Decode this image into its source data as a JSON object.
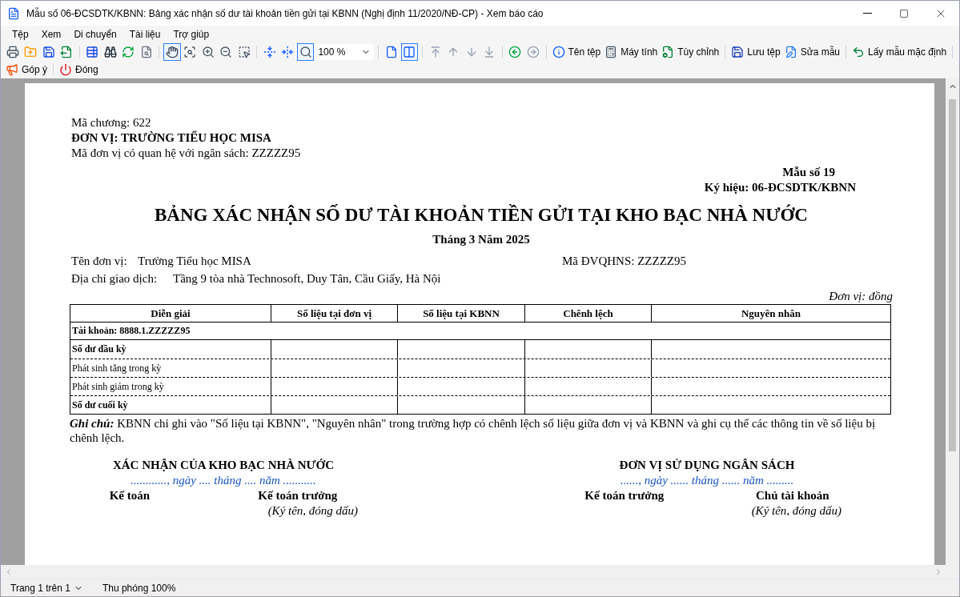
{
  "window": {
    "title": "Mẫu số 06-ĐCSDTK/KBNN: Bảng xác nhận số dư tài khoản tiền gửi tại KBNN (Nghị định 11/2020/NĐ-CP) - Xem báo cáo"
  },
  "menu": [
    "Tệp",
    "Xem",
    "Di chuyển",
    "Tài liệu",
    "Trợ giúp"
  ],
  "toolbar": [
    {
      "kind": "icon",
      "selected": false,
      "disabled": false
    },
    {
      "kind": "icon",
      "selected": false,
      "disabled": false
    },
    {
      "kind": "icon",
      "selected": false,
      "disabled": false
    },
    {
      "kind": "icon",
      "selected": false,
      "disabled": false
    },
    {
      "kind": "separator"
    },
    {
      "kind": "icon",
      "selected": false,
      "disabled": false
    },
    {
      "kind": "icon",
      "selected": false,
      "disabled": false
    },
    {
      "kind": "icon",
      "selected": false,
      "disabled": false
    },
    {
      "kind": "icon",
      "selected": false,
      "disabled": false
    },
    {
      "kind": "separator"
    },
    {
      "kind": "icon",
      "selected": true,
      "disabled": false
    },
    {
      "kind": "icon",
      "selected": false,
      "disabled": false
    },
    {
      "kind": "icon",
      "selected": false,
      "disabled": false
    },
    {
      "kind": "icon",
      "selected": false,
      "disabled": false
    },
    {
      "kind": "icon",
      "selected": false,
      "disabled": false
    },
    {
      "kind": "separator"
    },
    {
      "kind": "icon",
      "selected": false,
      "disabled": false
    },
    {
      "kind": "icon",
      "selected": false,
      "disabled": false
    },
    {
      "kind": "icon",
      "selected": true,
      "disabled": false
    },
    {
      "kind": "combo",
      "value": "100 %"
    },
    {
      "kind": "separator"
    },
    {
      "kind": "icon",
      "selected": false,
      "disabled": false
    },
    {
      "kind": "icon",
      "selected": true,
      "disabled": false
    },
    {
      "kind": "separator"
    },
    {
      "kind": "icon",
      "selected": false,
      "disabled": true
    },
    {
      "kind": "icon",
      "selected": false,
      "disabled": true
    },
    {
      "kind": "icon",
      "selected": false,
      "disabled": true
    },
    {
      "kind": "icon",
      "selected": false,
      "disabled": true
    },
    {
      "kind": "separator"
    },
    {
      "kind": "icon",
      "selected": false,
      "disabled": false
    },
    {
      "kind": "icon",
      "selected": false,
      "disabled": true
    },
    {
      "kind": "separator"
    },
    {
      "kind": "labeled",
      "label": "Tên tệp"
    },
    {
      "kind": "labeled",
      "label": "Máy tính"
    },
    {
      "kind": "labeled",
      "label": "Tùy chỉnh"
    },
    {
      "kind": "separator"
    },
    {
      "kind": "labeled",
      "label": "Lưu tệp"
    },
    {
      "kind": "labeled",
      "label": "Sửa mẫu"
    },
    {
      "kind": "separator"
    },
    {
      "kind": "labeled",
      "label": "Lấy mẫu mặc định"
    },
    {
      "kind": "separator"
    },
    {
      "kind": "labeled",
      "label": "Góp ý"
    },
    {
      "kind": "separator"
    },
    {
      "kind": "labeled",
      "label": "Đóng"
    }
  ],
  "report": {
    "header_lines": [
      {
        "text": "Mã chương: 622",
        "bold": false
      },
      {
        "text": "ĐƠN VỊ: TRƯỜNG TIỂU HỌC MISA",
        "bold": true
      },
      {
        "text": "Mã đơn vị có quan hệ với ngân sách: ZZZZZ95",
        "bold": false
      }
    ],
    "form_no": "Mẫu số 19",
    "form_code": "Ký hiệu: 06-ĐCSDTK/KBNN",
    "title": "BẢNG XÁC NHẬN SỐ DƯ TÀI KHOẢN TIỀN GỬI TẠI KHO BẠC NHÀ NƯỚC",
    "period": "Tháng 3 Năm 2025",
    "unit_label": "Tên đơn vị:",
    "unit_value": "Trường Tiểu học MISA",
    "budget_code": "Mã ĐVQHNS: ZZZZZ95",
    "address_label": "Địa chỉ giao dịch:",
    "address_value": "Tầng 9 tòa nhà Technosoft, Duy Tân, Cầu Giấy, Hà Nội",
    "currency": "Đơn vị: đồng",
    "table": {
      "columns": [
        "Diễn giải",
        "Số liệu tại đơn vị",
        "Số liệu tại KBNN",
        "Chênh lệch",
        "Nguyên nhân"
      ],
      "account": "Tài khoản: 8888.1.ZZZZZ95",
      "rows": [
        {
          "label": "Số dư đầu kỳ",
          "bold": true
        },
        {
          "label": "Phát sinh tăng trong kỳ",
          "bold": false
        },
        {
          "label": "Phát sinh giảm trong kỳ",
          "bold": false
        },
        {
          "label": "Số dư cuối kỳ",
          "bold": true
        }
      ]
    },
    "note": "**Ghi chú:** KBNN chỉ ghi vào \"Số liệu tại KBNN\", \"Nguyên nhân\" trong trường hợp có chênh lệch số liệu giữa đơn vị và KBNN và ghi cụ thể các thông tin về số liệu bị chênh lệch.",
    "signatures": [
      {
        "heading": "XÁC NHẬN CỦA KHO BẠC NHÀ NƯỚC",
        "date": "............, ngày .... tháng .... năm ...........",
        "roles": [
          "Kế toán",
          "Kế toán trưởng"
        ],
        "sign_hint": "(Ký tên, đóng dấu)"
      },
      {
        "heading": "ĐƠN VỊ SỬ DỤNG NGÂN SÁCH",
        "date": "......, ngày ...... tháng ...... năm .........",
        "roles": [
          "Kế toán trưởng",
          "Chủ tài khoản"
        ],
        "sign_hint": "(Ký tên, đóng dấu)"
      }
    ]
  },
  "status_bar": {
    "page": "Trang 1 trên 1",
    "zoom": "Thu phóng 100%"
  }
}
